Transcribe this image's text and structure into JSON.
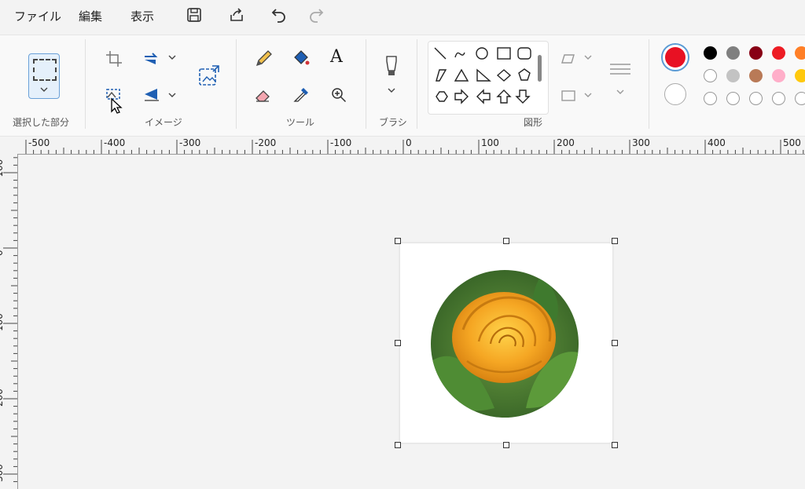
{
  "menu": {
    "file": "ファイル",
    "edit": "編集",
    "view": "表示"
  },
  "quick_icons": [
    "save-icon",
    "share-icon",
    "undo-icon",
    "redo-icon"
  ],
  "ribbon": {
    "groups": {
      "selection": "選択した部分",
      "image": "イメージ",
      "tools": "ツール",
      "brushes": "ブラシ",
      "shapes": "図形"
    }
  },
  "ruler": {
    "h_labels": [
      "-500",
      "-400",
      "-300",
      "-200",
      "-100",
      "0",
      "100",
      "200",
      "300",
      "400",
      "500"
    ],
    "v_labels": [
      "-100",
      "0",
      "100",
      "200",
      "300"
    ]
  },
  "colors": {
    "primary": "#e81123",
    "secondary": "#ffffff",
    "palette": [
      "#000000",
      "#7f7f7f",
      "#880015",
      "#ed1c24",
      "#ff7f27",
      "#ffffff",
      "#c3c3c3",
      "#b97a57",
      "#ffaec9",
      "#ffc90e"
    ]
  }
}
